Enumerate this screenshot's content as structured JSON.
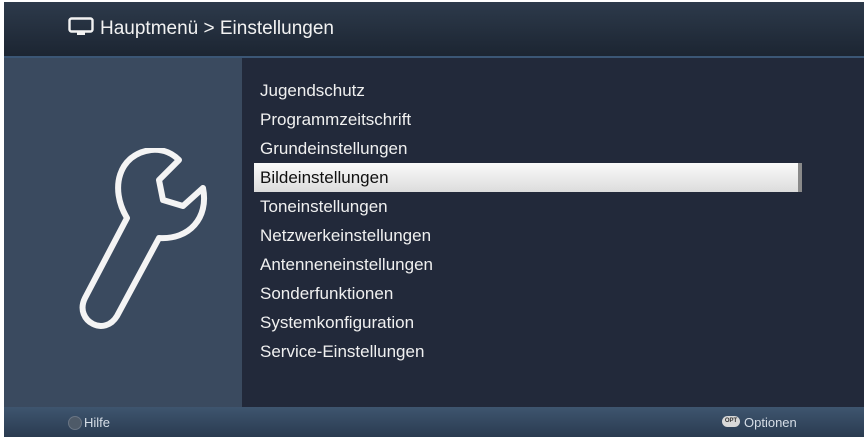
{
  "header": {
    "icon": "tv-icon",
    "breadcrumb": "Hauptmenü > Einstellungen"
  },
  "sidebar": {
    "icon": "wrench-icon"
  },
  "menu": {
    "items": [
      {
        "label": "Jugendschutz"
      },
      {
        "label": "Programmzeitschrift"
      },
      {
        "label": "Grundeinstellungen"
      },
      {
        "label": "Bildeinstellungen"
      },
      {
        "label": "Toneinstellungen"
      },
      {
        "label": "Netzwerkeinstellungen"
      },
      {
        "label": "Antenneneinstellungen"
      },
      {
        "label": "Sonderfunktionen"
      },
      {
        "label": "Systemkonfiguration"
      },
      {
        "label": "Service-Einstellungen"
      }
    ],
    "selected_label": "Bildeinstellungen"
  },
  "footer": {
    "help_label": "Hilfe",
    "options_button_text": "OPT",
    "options_label": "Optionen"
  },
  "colors": {
    "background": "#222a36",
    "left_panel": "#3a4a5f",
    "selection": "#f0f0f0",
    "text": "#f0f0f0"
  }
}
